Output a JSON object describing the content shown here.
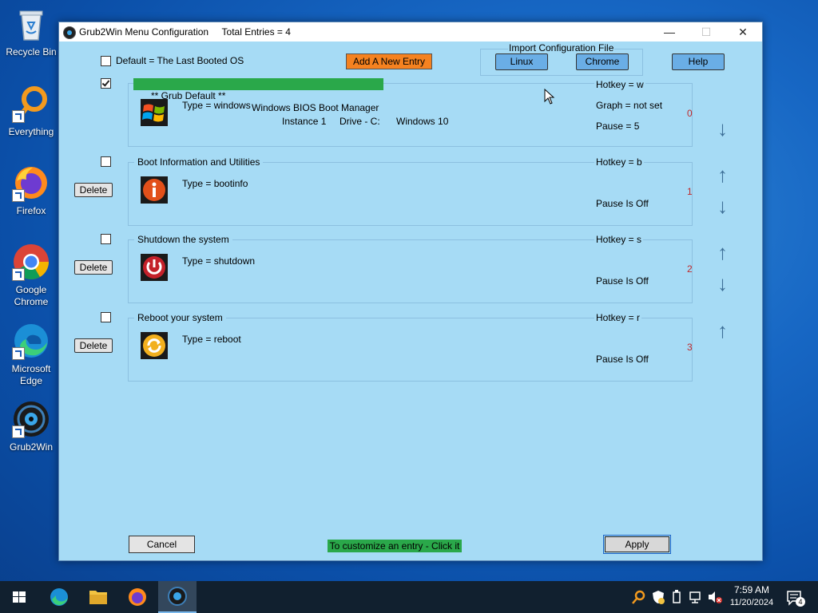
{
  "desktop": {
    "icons": [
      {
        "label": "Recycle Bin"
      },
      {
        "label": "Everything"
      },
      {
        "label": "Firefox"
      },
      {
        "label": "Google\nChrome"
      },
      {
        "label": "Microsoft\nEdge"
      },
      {
        "label": "Grub2Win"
      }
    ]
  },
  "window": {
    "title": "Grub2Win Menu Configuration",
    "total_entries": "Total Entries = 4",
    "controls": {
      "minimize": "—",
      "maximize": "☐",
      "close": "✕"
    }
  },
  "top": {
    "default_label": "Default = The Last Booted OS",
    "default_checked": false,
    "add_entry": "Add A New Entry",
    "import_label": "Import Configuration File",
    "linux": "Linux",
    "chrome": "Chrome",
    "help": "Help"
  },
  "entries": [
    {
      "checked": true,
      "title_left": "** Grub Default **",
      "title_right": "Windows BIOS Boot Manager",
      "type": "Type = windows",
      "hotkey": "Hotkey = w",
      "graph": "Graph = not set",
      "pause": "Pause = 5",
      "instance": "Instance 1",
      "drive": "Drive - C:",
      "os": "Windows 10",
      "number": "0",
      "icon": "windows-logo-icon"
    },
    {
      "checked": false,
      "title": "Boot Information and Utilities",
      "type": "Type = bootinfo",
      "hotkey": "Hotkey = b",
      "pause": "Pause Is Off",
      "number": "1",
      "delete": "Delete",
      "icon": "info-icon"
    },
    {
      "checked": false,
      "title": "Shutdown the system",
      "type": "Type = shutdown",
      "hotkey": "Hotkey = s",
      "pause": "Pause Is Off",
      "number": "2",
      "delete": "Delete",
      "icon": "power-icon"
    },
    {
      "checked": false,
      "title": "Reboot your system",
      "type": "Type = reboot",
      "hotkey": "Hotkey = r",
      "pause": "Pause Is Off",
      "number": "3",
      "delete": "Delete",
      "icon": "reboot-icon"
    }
  ],
  "bottom": {
    "cancel": "Cancel",
    "hint": "To customize an entry - Click it",
    "apply": "Apply"
  },
  "arrows": {
    "up": "↑",
    "down": "↓"
  },
  "taskbar": {
    "time": "7:59 AM",
    "date": "11/20/2024",
    "notification_count": "4"
  },
  "colors": {
    "window_bg": "#a6dbf5",
    "green_bar": "#2aa84a",
    "orange_button": "#f58220",
    "blue_button": "#6aaee6",
    "entry_number": "#c0282a"
  }
}
